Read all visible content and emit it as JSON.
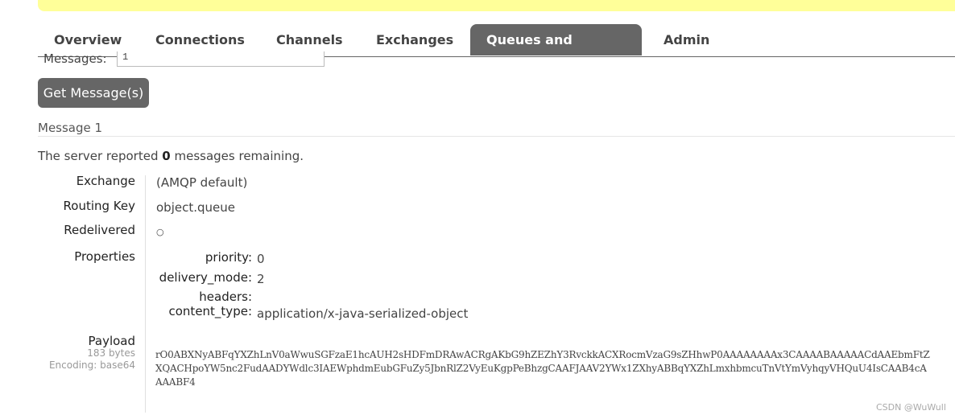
{
  "tabs": [
    {
      "label": "Overview",
      "active": false
    },
    {
      "label": "Connections",
      "active": false
    },
    {
      "label": "Channels",
      "active": false
    },
    {
      "label": "Exchanges",
      "active": false
    },
    {
      "label": "Queues and Streams",
      "active": true
    },
    {
      "label": "Admin",
      "active": false
    }
  ],
  "messages_field": {
    "label": "Messages:",
    "value": "1"
  },
  "get_button": "Get Message(s)",
  "message_section": {
    "title": "Message 1",
    "remaining_prefix": "The server reported",
    "remaining_count": "0",
    "remaining_suffix": "messages remaining."
  },
  "fields": {
    "exchange": {
      "label": "Exchange",
      "value": "(AMQP default)"
    },
    "routing_key": {
      "label": "Routing Key",
      "value": "object.queue"
    },
    "redelivered": {
      "label": "Redelivered",
      "value": "○"
    },
    "properties": {
      "label": "Properties",
      "items": [
        {
          "key": "priority:",
          "value": "0"
        },
        {
          "key": "delivery_mode:",
          "value": "2"
        },
        {
          "key": "headers:",
          "value": ""
        },
        {
          "key": "content_type:",
          "value": "application/x-java-serialized-object"
        }
      ]
    },
    "payload": {
      "label": "Payload",
      "size": "183 bytes",
      "encoding": "Encoding: base64",
      "value": "rO0ABXNyABFqYXZhLnV0aWwuSGFzaE1hcAUH2sHDFmDRAwACRgAKbG9hZEZhY3RvckkACXRocmVzaG9sZHhwP0AAAAAAAAx3CAAAABAAAAACdAAEbmFtZXQACHpoYW5nc2FudAADYWdlc3IAEWphdmEubGFuZy5JbnRlZ2VyEuKgpPeBhzgCAAFJAAV2YWx1ZXhyABBqYXZhLmxhbmcuTnVtYmVyhqyVHQuU4IsCAAB4cAAAABF4"
    }
  },
  "watermark": "CSDN @WuWull"
}
